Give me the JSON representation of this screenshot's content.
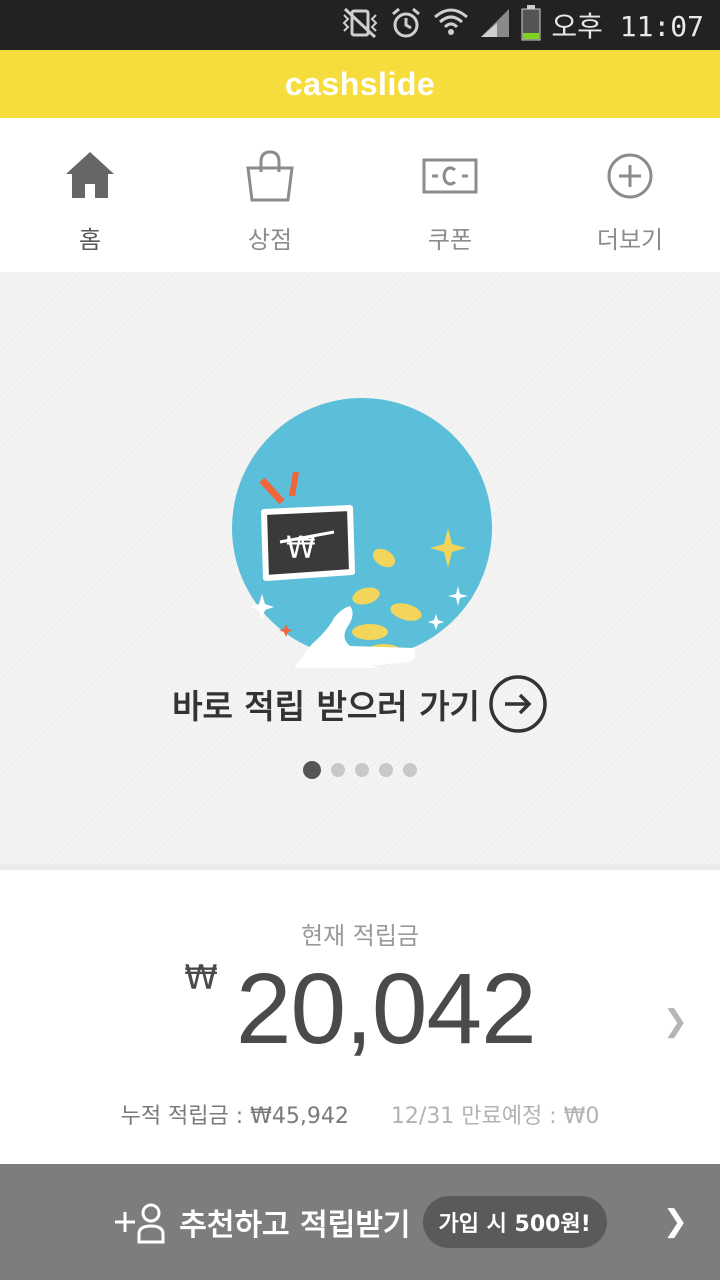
{
  "status_bar": {
    "time": "오후 11:07",
    "icons": [
      "vibrate-off-icon",
      "alarm-icon",
      "wifi-icon",
      "signal-icon",
      "battery-icon"
    ]
  },
  "app_bar": {
    "title": "cashslide"
  },
  "tabs": [
    {
      "label": "홈",
      "icon": "home-icon",
      "active": true
    },
    {
      "label": "상점",
      "icon": "shopping-bag-icon",
      "active": false
    },
    {
      "label": "쿠폰",
      "icon": "coupon-icon",
      "active": false
    },
    {
      "label": "더보기",
      "icon": "plus-circle-icon",
      "active": false
    }
  ],
  "banner": {
    "cta_text": "바로 적립 받으러 가기",
    "pagination": {
      "total": 5,
      "current": 1
    }
  },
  "balance": {
    "label": "현재 적립금",
    "currency": "₩",
    "amount": "20,042",
    "total_label": "누적 적립금 : ₩45,942",
    "expire_label": "12/31  만료예정 :  ₩0"
  },
  "bottom_bar": {
    "text": "추천하고 적립받기",
    "badge": "가입 시 500원!"
  },
  "colors": {
    "status_bar": "#222222",
    "app_bar": "#f6dc3c",
    "banner_circle": "#5bbfd9",
    "coin": "#f2d55a",
    "accent_orange": "#f0663a",
    "bottom_bar": "#7d7d7d"
  }
}
